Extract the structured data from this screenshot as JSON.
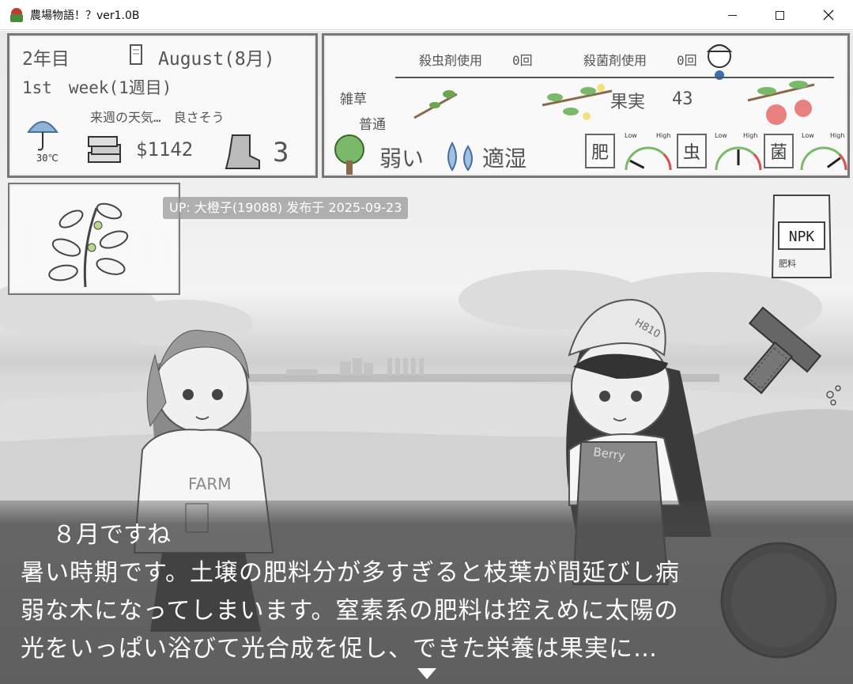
{
  "window": {
    "title": "農場物語！？ver1.0B",
    "minimize_icon": "minimize-icon",
    "maximize_icon": "maximize-icon",
    "close_icon": "close-icon"
  },
  "status": {
    "year": "2年目",
    "month": "August(8月)",
    "week": "1st　week(1週目)",
    "weather_forecast": "来週の天気…　良さそう",
    "temperature": "30℃",
    "money": "$1142",
    "stamina": "3"
  },
  "farm": {
    "pesticide": "殺虫剤使用",
    "pesticide_count": "0回",
    "fungicide": "殺菌剤使用",
    "fungicide_count": "0回",
    "weeds_label": "雑草",
    "weeds_value": "普通",
    "fruit_label": "果実",
    "fruit_count": "43",
    "tree_health": "弱い",
    "moisture": "適湿",
    "gauges": [
      {
        "label": "肥",
        "low": "Low",
        "high": "High",
        "level": 0.15
      },
      {
        "label": "虫",
        "low": "Low",
        "high": "High",
        "level": 0.5
      },
      {
        "label": "菌",
        "low": "Low",
        "high": "High",
        "level": 0.8
      }
    ]
  },
  "items": {
    "fertilizer_name": "NPK",
    "fertilizer_label": "肥料"
  },
  "characters": {
    "left_shirt": "FARM",
    "right_overalls": "Berry",
    "right_cap": "H810"
  },
  "watermark": "UP: 大橙子(19088) 发布于 2025-09-23",
  "dialog": {
    "speaker_line": "８月ですね",
    "line1": "暑い時期です。土壌の肥料分が多すぎると枝葉が間延びし病",
    "line2": "弱な木になってしまいます。窒素系の肥料は控えめに太陽の",
    "line3": "光をいっぱい浴びて光合成を促し、できた栄養は果実に…"
  }
}
